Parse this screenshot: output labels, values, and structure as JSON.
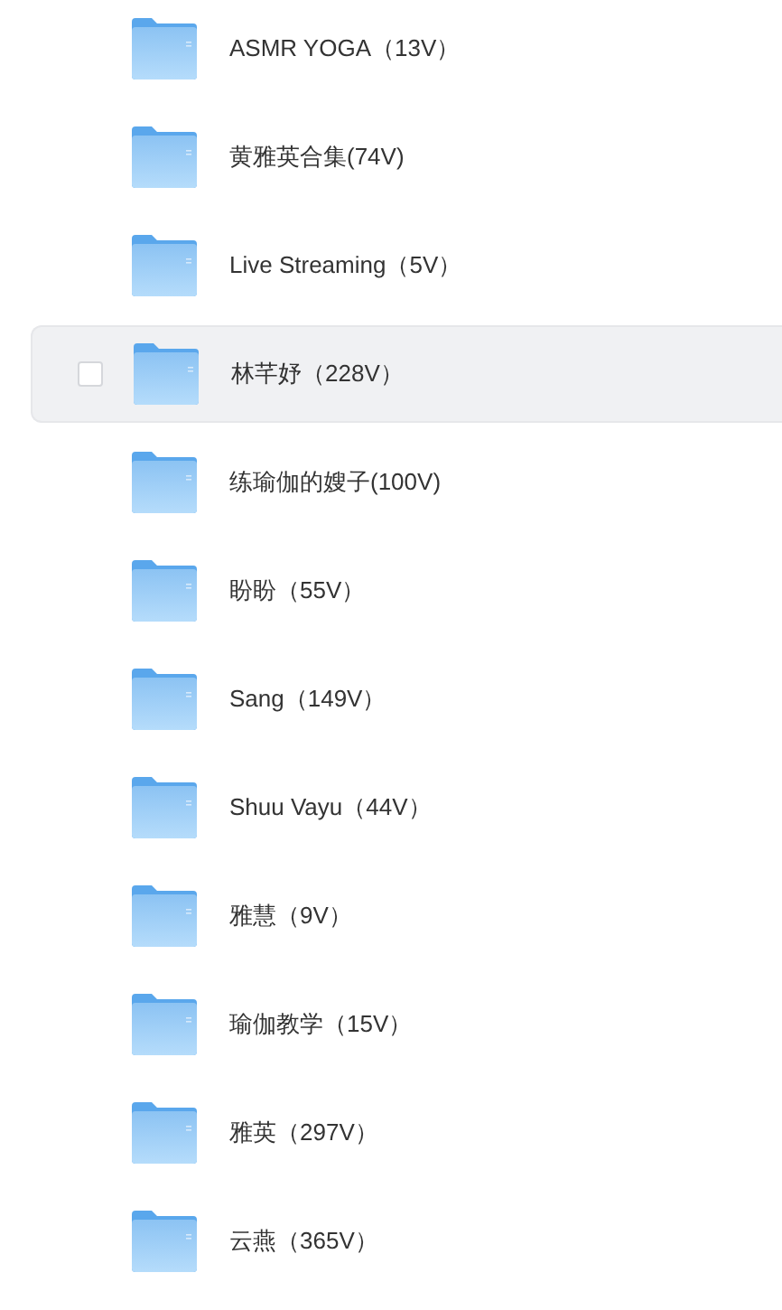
{
  "folders": [
    {
      "name": "ASMR YOGA（13V）",
      "highlighted": false,
      "checked": false
    },
    {
      "name": "黄雅英合集(74V)",
      "highlighted": false,
      "checked": false
    },
    {
      "name": "Live Streaming（5V）",
      "highlighted": false,
      "checked": false
    },
    {
      "name": "林芊妤（228V）",
      "highlighted": true,
      "checked": false
    },
    {
      "name": "练瑜伽的嫂子(100V)",
      "highlighted": false,
      "checked": false
    },
    {
      "name": "盼盼（55V）",
      "highlighted": false,
      "checked": false
    },
    {
      "name": "Sang（149V）",
      "highlighted": false,
      "checked": false
    },
    {
      "name": "Shuu Vayu（44V）",
      "highlighted": false,
      "checked": false
    },
    {
      "name": "雅慧（9V）",
      "highlighted": false,
      "checked": false
    },
    {
      "name": "瑜伽教学（15V）",
      "highlighted": false,
      "checked": false
    },
    {
      "name": "雅英（297V）",
      "highlighted": false,
      "checked": false
    },
    {
      "name": "云燕（365V）",
      "highlighted": false,
      "checked": false
    }
  ]
}
